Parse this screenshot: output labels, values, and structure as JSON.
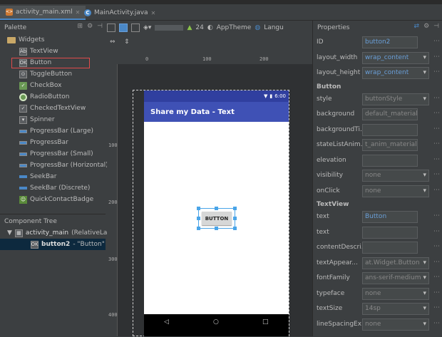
{
  "tabs": [
    {
      "label": "activity_main.xml",
      "icon": "xml-file-icon",
      "active": true
    },
    {
      "label": "MainActivity.java",
      "icon": "java-class-icon",
      "active": false
    }
  ],
  "palette": {
    "title": "Palette",
    "group": "Widgets",
    "items": [
      {
        "label": "TextView",
        "icon": "textview-icon"
      },
      {
        "label": "Button",
        "icon": "button-icon"
      },
      {
        "label": "ToggleButton",
        "icon": "togglebutton-icon"
      },
      {
        "label": "CheckBox",
        "icon": "checkbox-icon"
      },
      {
        "label": "RadioButton",
        "icon": "radiobutton-icon"
      },
      {
        "label": "CheckedTextView",
        "icon": "checkedtextview-icon"
      },
      {
        "label": "Spinner",
        "icon": "spinner-icon"
      },
      {
        "label": "ProgressBar (Large)",
        "icon": "progressbar-icon"
      },
      {
        "label": "ProgressBar",
        "icon": "progressbar-icon"
      },
      {
        "label": "ProgressBar (Small)",
        "icon": "progressbar-icon"
      },
      {
        "label": "ProgressBar (Horizontal)",
        "icon": "progressbar-icon"
      },
      {
        "label": "SeekBar",
        "icon": "seekbar-icon"
      },
      {
        "label": "SeekBar (Discrete)",
        "icon": "seekbar-icon"
      },
      {
        "label": "QuickContactBadge",
        "icon": "contact-badge-icon"
      }
    ],
    "highlight_color": "#e04b4b"
  },
  "component_tree": {
    "title": "Component Tree",
    "root": "activity_main",
    "root_suffix": "(RelativeLay",
    "child": "button2",
    "child_suffix": "- \"Button\""
  },
  "toolbar": {
    "api_level": "24",
    "theme": "AppTheme",
    "language": "Langu"
  },
  "ruler": {
    "top": [
      "0",
      "100",
      "200"
    ],
    "left": [
      "100",
      "200",
      "300",
      "400"
    ]
  },
  "phone": {
    "time": "6:00",
    "app_title": "Share my Data - Text",
    "button_label": "BUTTON",
    "status_color": "#303f9f",
    "appbar_color": "#3f51b5"
  },
  "properties": {
    "title": "Properties",
    "rows": [
      {
        "label": "ID",
        "value": "button2",
        "style": "blue",
        "dropdown": false
      },
      {
        "label": "layout_width",
        "value": "wrap_content",
        "style": "blue",
        "dropdown": true
      },
      {
        "label": "layout_height",
        "value": "wrap_content",
        "style": "blue",
        "dropdown": true
      }
    ],
    "section_button": "Button",
    "button_rows": [
      {
        "label": "style",
        "value": "buttonStyle",
        "dropdown": true
      },
      {
        "label": "background",
        "value": "default_material",
        "dropdown": false
      },
      {
        "label": "backgroundTi...",
        "value": "",
        "dropdown": false
      },
      {
        "label": "stateListAnim...",
        "value": "t_anim_material",
        "dropdown": false
      },
      {
        "label": "elevation",
        "value": "",
        "dropdown": false
      },
      {
        "label": "visibility",
        "value": "none",
        "dropdown": true
      },
      {
        "label": "onClick",
        "value": "none",
        "dropdown": true
      }
    ],
    "section_textview": "TextView",
    "text_rows": [
      {
        "label": "text",
        "value": "Button",
        "style": "blue",
        "dropdown": false
      },
      {
        "label": "text",
        "value": "",
        "dropdown": false
      },
      {
        "label": "contentDescri...",
        "value": "",
        "dropdown": false
      },
      {
        "label": "textAppear...",
        "value": "at.Widget.Button",
        "dropdown": true
      },
      {
        "label": "fontFamily",
        "value": "ans-serif-medium",
        "dropdown": true
      },
      {
        "label": "typeface",
        "value": "none",
        "dropdown": true
      },
      {
        "label": "textSize",
        "value": "14sp",
        "dropdown": true
      },
      {
        "label": "lineSpacingEx...",
        "value": "none",
        "dropdown": true
      }
    ]
  }
}
